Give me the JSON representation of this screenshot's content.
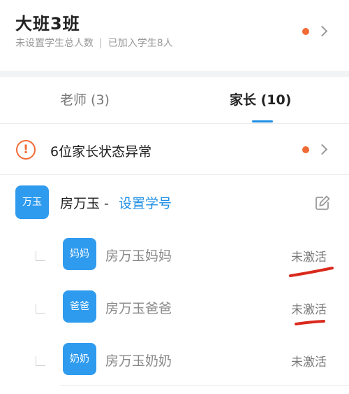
{
  "class_header": {
    "title": "大班3班",
    "student_total": "未设置学生总人数",
    "separator": "|",
    "joined": "已加入学生8人"
  },
  "tabs": [
    {
      "label": "老师 (3)",
      "active": false
    },
    {
      "label": "家长 (10)",
      "active": true
    }
  ],
  "alert": {
    "icon": "exclamation-circle-icon",
    "symbol": "!",
    "text": "6位家长状态异常"
  },
  "student": {
    "avatar_text": "万玉",
    "name": "房万玉",
    "name_separator": " - ",
    "action_link": "设置学号",
    "edit_icon": "edit-icon"
  },
  "parents": [
    {
      "avatar_text": "妈妈",
      "name": "房万玉妈妈",
      "status": "未激活",
      "annotated": true
    },
    {
      "avatar_text": "爸爸",
      "name": "房万玉爸爸",
      "status": "未激活",
      "annotated": true
    },
    {
      "avatar_text": "奶奶",
      "name": "房万玉奶奶",
      "status": "未激活",
      "annotated": false
    }
  ],
  "colors": {
    "accent_blue": "#1d8ee5",
    "avatar_blue": "#2f9bef",
    "notice_orange": "#f26a35",
    "annotation_red": "#d9291c"
  }
}
